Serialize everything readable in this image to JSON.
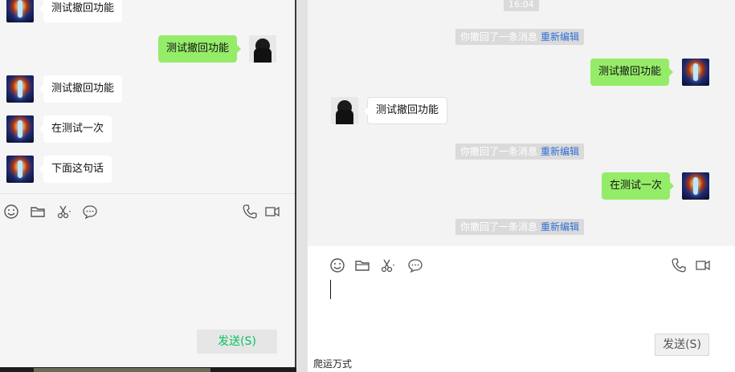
{
  "left_window": {
    "messages": [
      {
        "side": "left",
        "avatar": "fire-avatar",
        "text": "测试撤回功能"
      },
      {
        "side": "right",
        "avatar": "photo-avatar",
        "text": "测试撤回功能"
      },
      {
        "side": "left",
        "avatar": "fire-avatar",
        "text": "测试撤回功能"
      },
      {
        "side": "left",
        "avatar": "fire-avatar",
        "text": "在测试一次"
      },
      {
        "side": "left",
        "avatar": "fire-avatar",
        "text": "下面这句话"
      }
    ],
    "toolbar_icons": [
      "emoji-icon",
      "folder-icon",
      "scissors-icon",
      "chat-bubble-icon",
      "phone-icon",
      "video-icon"
    ],
    "send_label": "发送(S)"
  },
  "right_window": {
    "timestamp": "16:04",
    "recall_notice": "你撤回了一条消息",
    "reedit_label": "重新编辑",
    "messages": [
      {
        "type": "system"
      },
      {
        "side": "right",
        "avatar": "fire-avatar",
        "text": "测试撤回功能"
      },
      {
        "side": "left",
        "avatar": "photo-avatar",
        "text": "测试撤回功能"
      },
      {
        "type": "system"
      },
      {
        "side": "right",
        "avatar": "fire-avatar",
        "text": "在测试一次"
      },
      {
        "type": "system"
      }
    ],
    "toolbar_icons": [
      "emoji-icon",
      "folder-icon",
      "scissors-icon",
      "chat-bubble-icon",
      "phone-icon",
      "video-icon"
    ],
    "send_label": "发送(S)"
  },
  "footer_text": "爬运万式",
  "colors": {
    "green_bubble": "#95ec69",
    "send_green": "#07c160",
    "link_blue": "#2f6fd6"
  }
}
